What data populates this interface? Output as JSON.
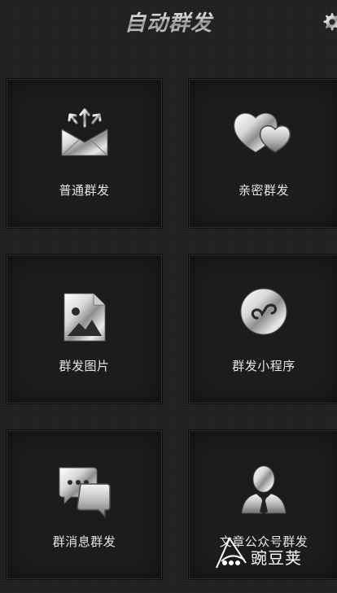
{
  "header": {
    "title": "自动群发"
  },
  "icons": {
    "settings": "gear-icon"
  },
  "tiles": [
    {
      "label": "普通群发",
      "icon": "envelope-broadcast-icon"
    },
    {
      "label": "亲密群发",
      "icon": "hearts-icon"
    },
    {
      "label": "群发图片",
      "icon": "image-file-icon"
    },
    {
      "label": "群发小程序",
      "icon": "mini-program-icon"
    },
    {
      "label": "群消息群发",
      "icon": "chat-bubbles-icon"
    },
    {
      "label": "文章公众号群发",
      "icon": "person-tie-icon"
    }
  ],
  "watermark": {
    "text": "豌豆荚"
  },
  "colors": {
    "background": "#222222",
    "tile": "#1c1c1c",
    "label": "#e6e6e6",
    "metal_light": "#f2f2f2",
    "metal_dark": "#7a7a7a"
  }
}
